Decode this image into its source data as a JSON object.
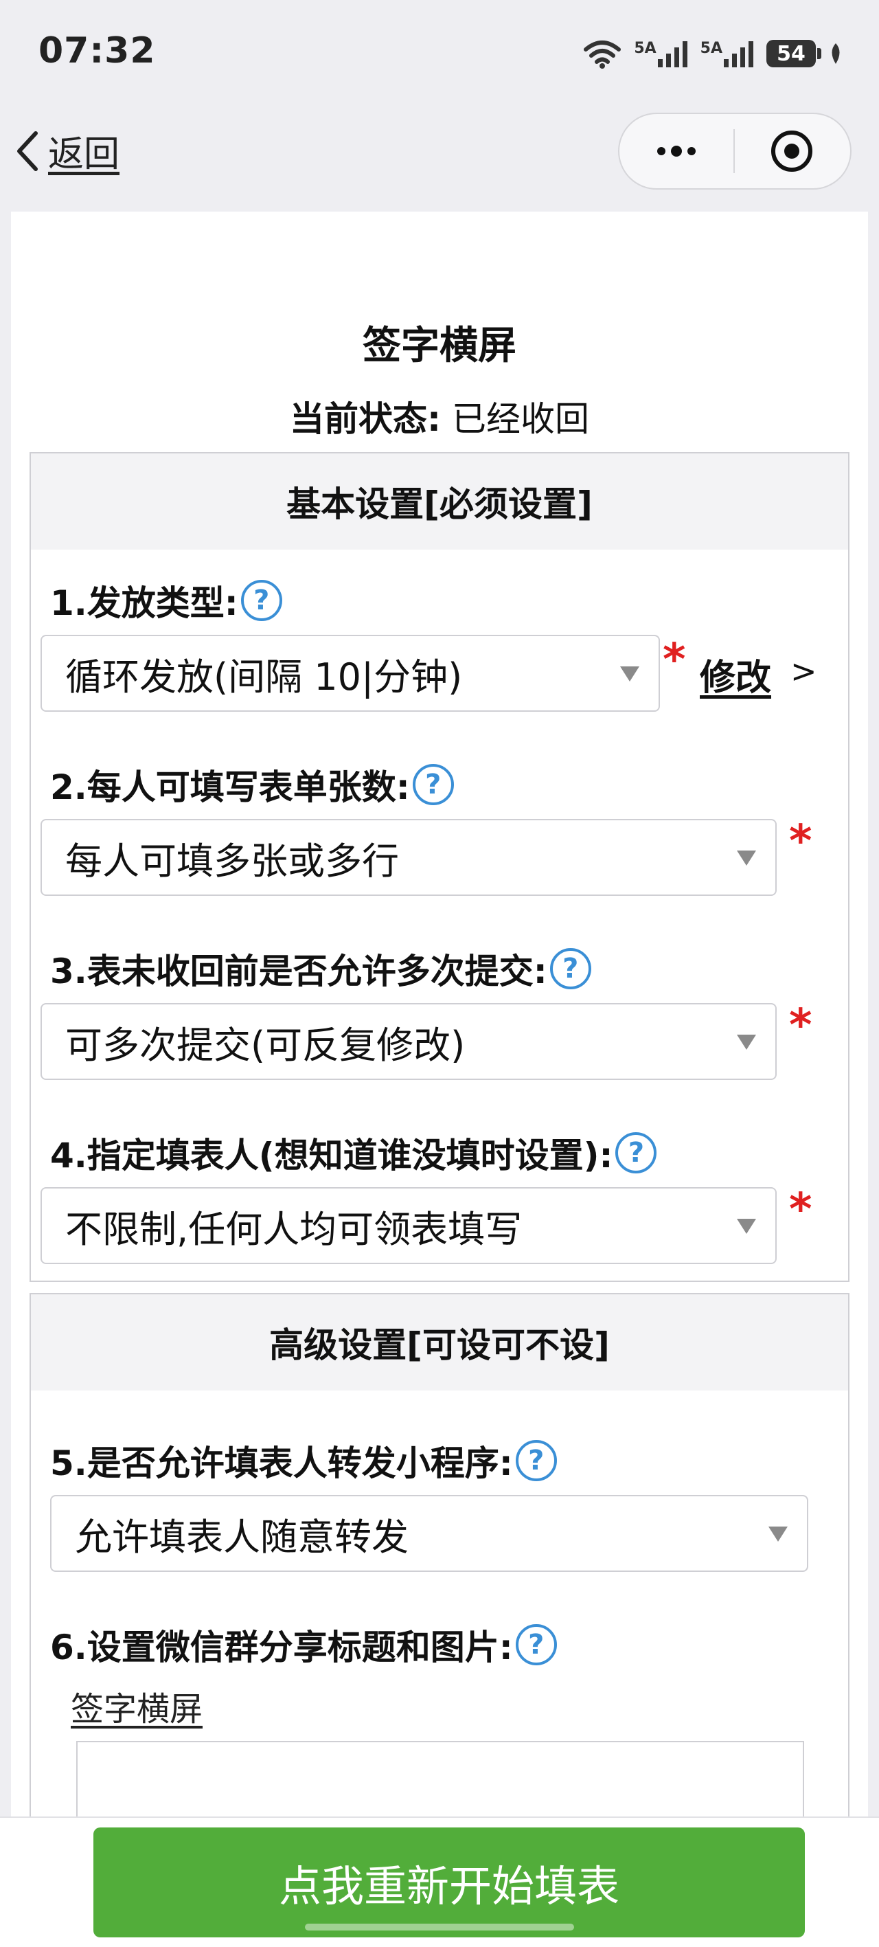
{
  "status_bar": {
    "time": "07:32",
    "network_1": "5A",
    "network_2": "5A",
    "battery": "54"
  },
  "nav": {
    "back_label": "返回"
  },
  "page": {
    "title": "签字横屏",
    "status_label": "当前状态:",
    "status_value": "已经收回"
  },
  "basic": {
    "header": "基本设置[必须设置]",
    "q1": {
      "label": "1.发放类型:",
      "value": "循环发放(间隔 10|分钟)",
      "required": "*",
      "modify_label": "修改",
      "modify_suffix": ">"
    },
    "q2": {
      "label": "2.每人可填写表单张数:",
      "value": "每人可填多张或多行",
      "required": "*"
    },
    "q3": {
      "label": "3.表未收回前是否允许多次提交:",
      "value": "可多次提交(可反复修改)",
      "required": "*"
    },
    "q4": {
      "label": "4.指定填表人(想知道谁没填时设置):",
      "value": "不限制,任何人均可领表填写",
      "required": "*"
    }
  },
  "advanced": {
    "header": "高级设置[可设可不设]",
    "q5": {
      "label": "5.是否允许填表人转发小程序:",
      "value": "允许填表人随意转发"
    },
    "q6": {
      "label": "6.设置微信群分享标题和图片:",
      "share_title": "签字横屏"
    }
  },
  "help_glyph": "?",
  "cta": {
    "label": "点我重新开始填表"
  },
  "colors": {
    "cta": "#52ad3a",
    "required": "#e02020",
    "help": "#3a8fd6"
  }
}
